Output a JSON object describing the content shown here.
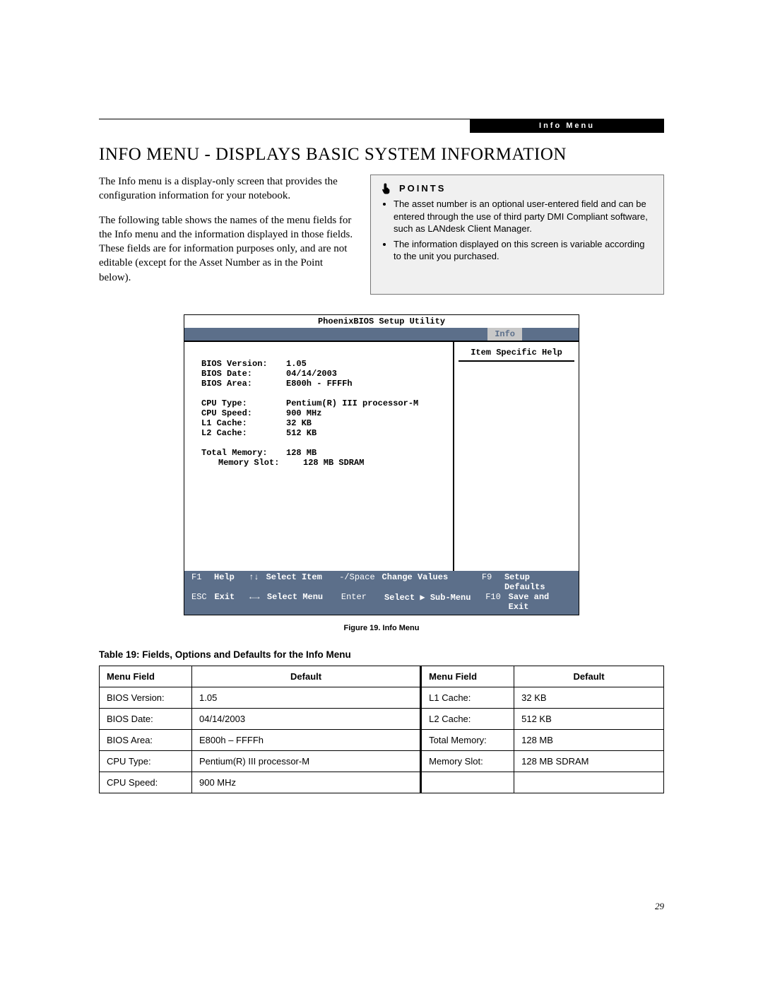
{
  "header": {
    "tab_label": "Info Menu"
  },
  "title": "INFO MENU - DISPLAYS BASIC SYSTEM INFORMATION",
  "intro": {
    "p1": "The Info menu is a display-only screen that provides the configuration information for your notebook.",
    "p2": "The following table shows the names of the menu fields for the Info menu and the information displayed in those fields. These fields are for information purposes only, and are not editable (except for the Asset Number as in the Point below)."
  },
  "points": {
    "title": "POINTS",
    "items": [
      "The asset number is an optional user-entered field and can be entered through the use of third party DMI Compliant software, such as LANdesk Client Manager.",
      "The information displayed on this screen is variable according to the unit you purchased."
    ]
  },
  "bios": {
    "window_title": "PhoenixBIOS Setup Utility",
    "tab": "Info",
    "help_title": "Item Specific Help",
    "fields": {
      "bios_version": {
        "label": "BIOS Version:",
        "value": "1.05"
      },
      "bios_date": {
        "label": "BIOS Date:",
        "value": "04/14/2003"
      },
      "bios_area": {
        "label": "BIOS Area:",
        "value": "E800h - FFFFh"
      },
      "cpu_type": {
        "label": "CPU Type:",
        "value": "Pentium(R) III processor-M"
      },
      "cpu_speed": {
        "label": "CPU Speed:",
        "value": "900 MHz"
      },
      "l1_cache": {
        "label": "L1 Cache:",
        "value": "32 KB"
      },
      "l2_cache": {
        "label": "L2 Cache:",
        "value": "512 KB"
      },
      "total_mem": {
        "label": "Total Memory:",
        "value": "128 MB"
      },
      "mem_slot": {
        "label": "Memory Slot:",
        "value": "128 MB SDRAM"
      }
    },
    "footer": {
      "r1": {
        "k1": "F1",
        "v1": "Help",
        "k2": "↑↓",
        "v2": "Select Item",
        "k3": "-/Space",
        "v3": "Change Values",
        "k4": "F9",
        "v4": "Setup Defaults"
      },
      "r2": {
        "k1": "ESC",
        "v1": "Exit",
        "k2": "←→",
        "v2": "Select Menu",
        "k3": "Enter",
        "v3": "Select ▶ Sub-Menu",
        "k4": "F10",
        "v4": "Save and Exit"
      }
    }
  },
  "figure_caption": "Figure 19.  Info Menu",
  "table_title": "Table 19: Fields, Options and Defaults for the Info Menu",
  "table_headers": {
    "menu_field": "Menu Field",
    "default": "Default"
  },
  "table_rows": [
    {
      "f1": "BIOS Version:",
      "d1": "1.05",
      "f2": "L1 Cache:",
      "d2": "32 KB"
    },
    {
      "f1": "BIOS Date:",
      "d1": "04/14/2003",
      "f2": "L2 Cache:",
      "d2": "512 KB"
    },
    {
      "f1": "BIOS Area:",
      "d1": "E800h – FFFFh",
      "f2": "Total Memory:",
      "d2": "128 MB"
    },
    {
      "f1": "CPU Type:",
      "d1": "Pentium(R) III processor-M",
      "f2": "Memory Slot:",
      "d2": "128 MB SDRAM"
    },
    {
      "f1": "CPU Speed:",
      "d1": "900 MHz",
      "f2": "",
      "d2": ""
    }
  ],
  "page_number": "29"
}
